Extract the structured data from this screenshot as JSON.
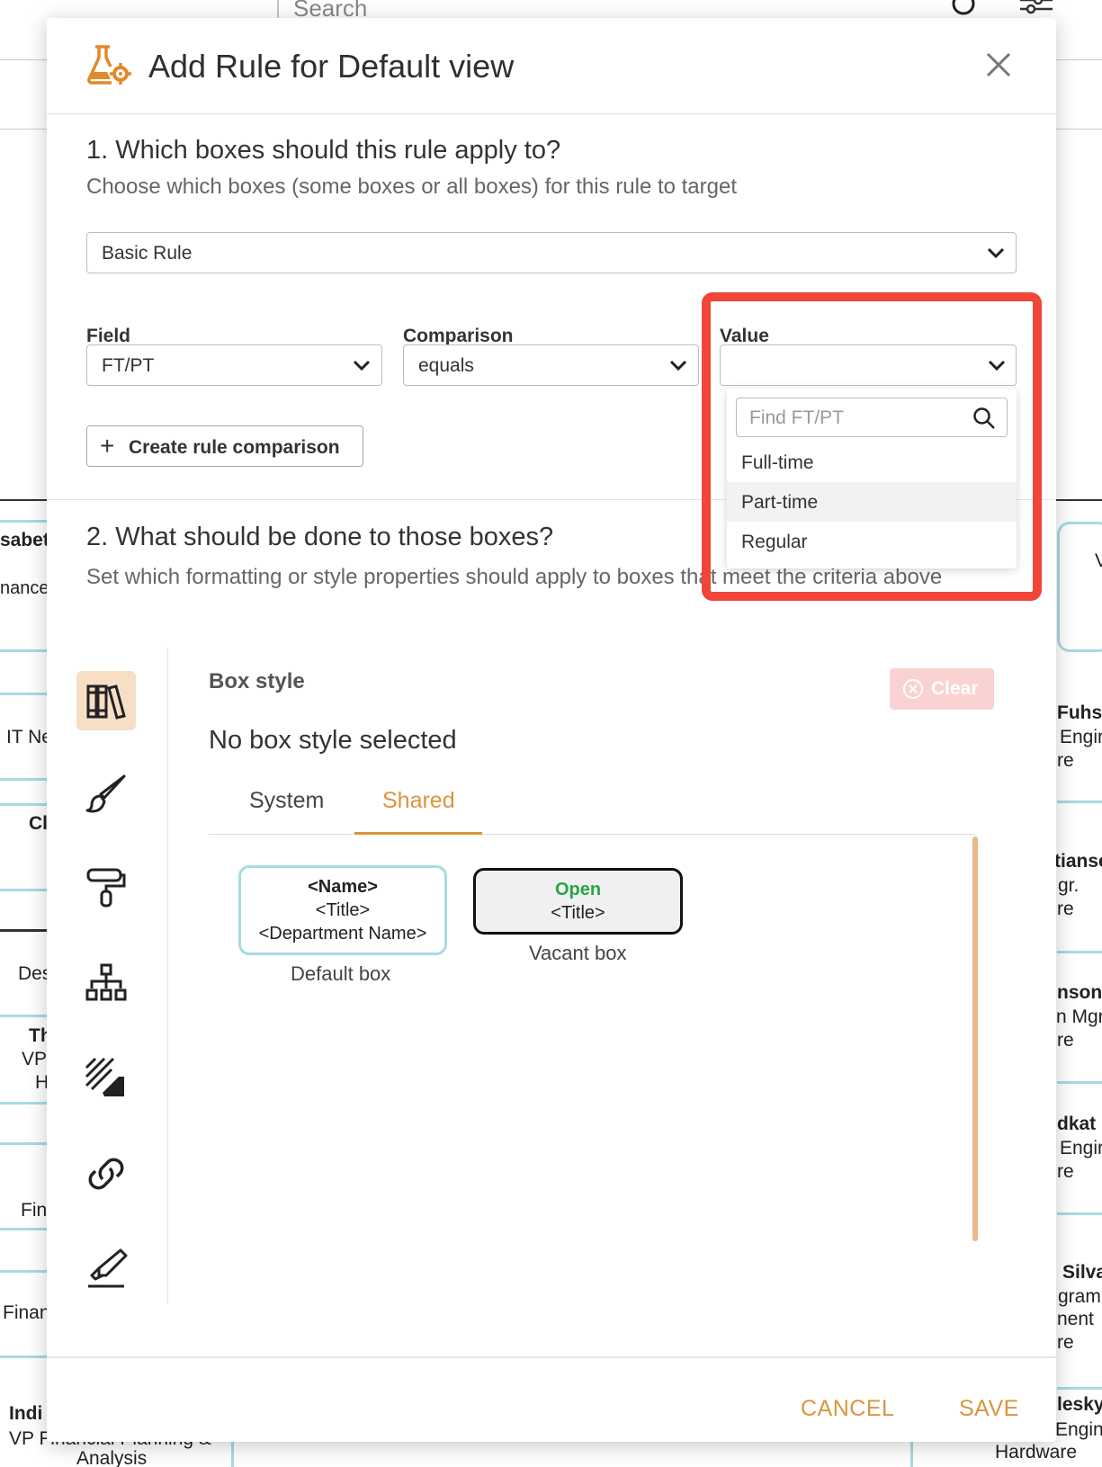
{
  "background": {
    "search_placeholder": "Search",
    "left_fragments": [
      "sabet",
      "nance",
      "IT Ne",
      "Cl",
      "Des",
      "Th",
      "VP",
      "H",
      "Fin",
      "Finan",
      "Indi",
      "VP Financial Planning &",
      "Analysis"
    ],
    "right_fragments": [
      "Fuhs",
      "Engir",
      "re",
      "tianse",
      "gr.",
      "re",
      "nson",
      "n Mgr",
      "re",
      "dkat",
      "Engir",
      "re",
      "Silva",
      "gram",
      "nent",
      "re",
      "lesky",
      "Engine",
      "Hardware",
      "V"
    ]
  },
  "modal": {
    "title": "Add Rule for Default view",
    "section1": {
      "title": "1. Which boxes should this rule apply to?",
      "subtitle": "Choose which boxes (some boxes or all boxes) for this rule to target",
      "rule_type": "Basic Rule",
      "field_label": "Field",
      "field_value": "FT/PT",
      "comparison_label": "Comparison",
      "comparison_value": "equals",
      "value_label": "Value",
      "value_value": "",
      "create_button": "Create rule comparison"
    },
    "dropdown": {
      "search_placeholder": "Find FT/PT",
      "options": [
        "Full-time",
        "Part-time",
        "Regular"
      ],
      "highlighted": "Part-time"
    },
    "section2": {
      "title": "2. What should be done to those boxes?",
      "subtitle": "Set which formatting or style properties should apply to boxes that meet the criteria above"
    },
    "box_style": {
      "title": "Box style",
      "clear_button": "Clear",
      "status": "No box style selected",
      "tabs": [
        "System",
        "Shared"
      ],
      "active_tab": "Shared",
      "default_box": {
        "line1": "<Name>",
        "line2": "<Title>",
        "line3": "<Department Name>",
        "caption": "Default box"
      },
      "vacant_box": {
        "line1": "Open",
        "line2": "<Title>",
        "caption": "Vacant box"
      }
    },
    "sidebar_icons": [
      "library-icon",
      "brush-icon",
      "paint-roller-icon",
      "org-chart-icon",
      "pattern-fill-icon",
      "link-icon",
      "highlighter-icon"
    ],
    "footer": {
      "cancel": "CANCEL",
      "save": "SAVE"
    },
    "colors": {
      "accent": "#d9953e",
      "annotation": "#f0463a",
      "box_border": "#a7dbe3",
      "open_green": "#27a548"
    }
  }
}
